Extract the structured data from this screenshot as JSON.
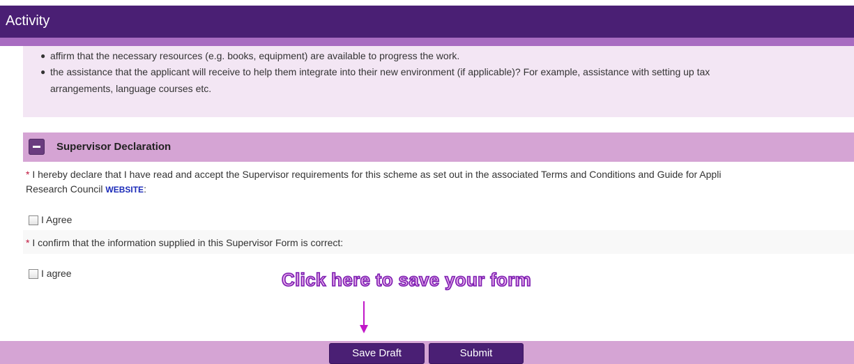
{
  "header": {
    "title": "Activity"
  },
  "info": {
    "items": [
      {
        "line1": "affirm that the necessary resources (e.g. books, equipment) are available to progress the work."
      },
      {
        "line1": "the assistance that the applicant will receive to help them integrate into their new environment (if applicable)? For example, assistance with setting up tax",
        "line2": "arrangements, language courses etc."
      }
    ]
  },
  "supervisor_section": {
    "title": "Supervisor Declaration",
    "declaration_line1": "I hereby declare that I have read and accept the Supervisor requirements for this scheme as set out in the associated Terms and Conditions and Guide for Appli",
    "declaration_line2_prefix": "Research Council ",
    "website_link": "WEBSITE",
    "declaration_line2_suffix": ":",
    "required_mark": "*",
    "agree1_label": "I Agree",
    "confirm_text": "I confirm that the information supplied in this Supervisor Form is correct:",
    "agree2_label": "I agree"
  },
  "annotation": {
    "text": "Click here to save your form"
  },
  "footer": {
    "save_draft_label": "Save Draft",
    "submit_label": "Submit"
  },
  "colors": {
    "header_bg": "#4a1f74",
    "header_strip": "#a86cc1",
    "panel_bg": "#f3e6f4",
    "section_header_bg": "#d5a4d4",
    "button_bg": "#4a1f74",
    "required": "#c0143c",
    "link": "#1a2ab8",
    "annotation": "#c118c8"
  }
}
